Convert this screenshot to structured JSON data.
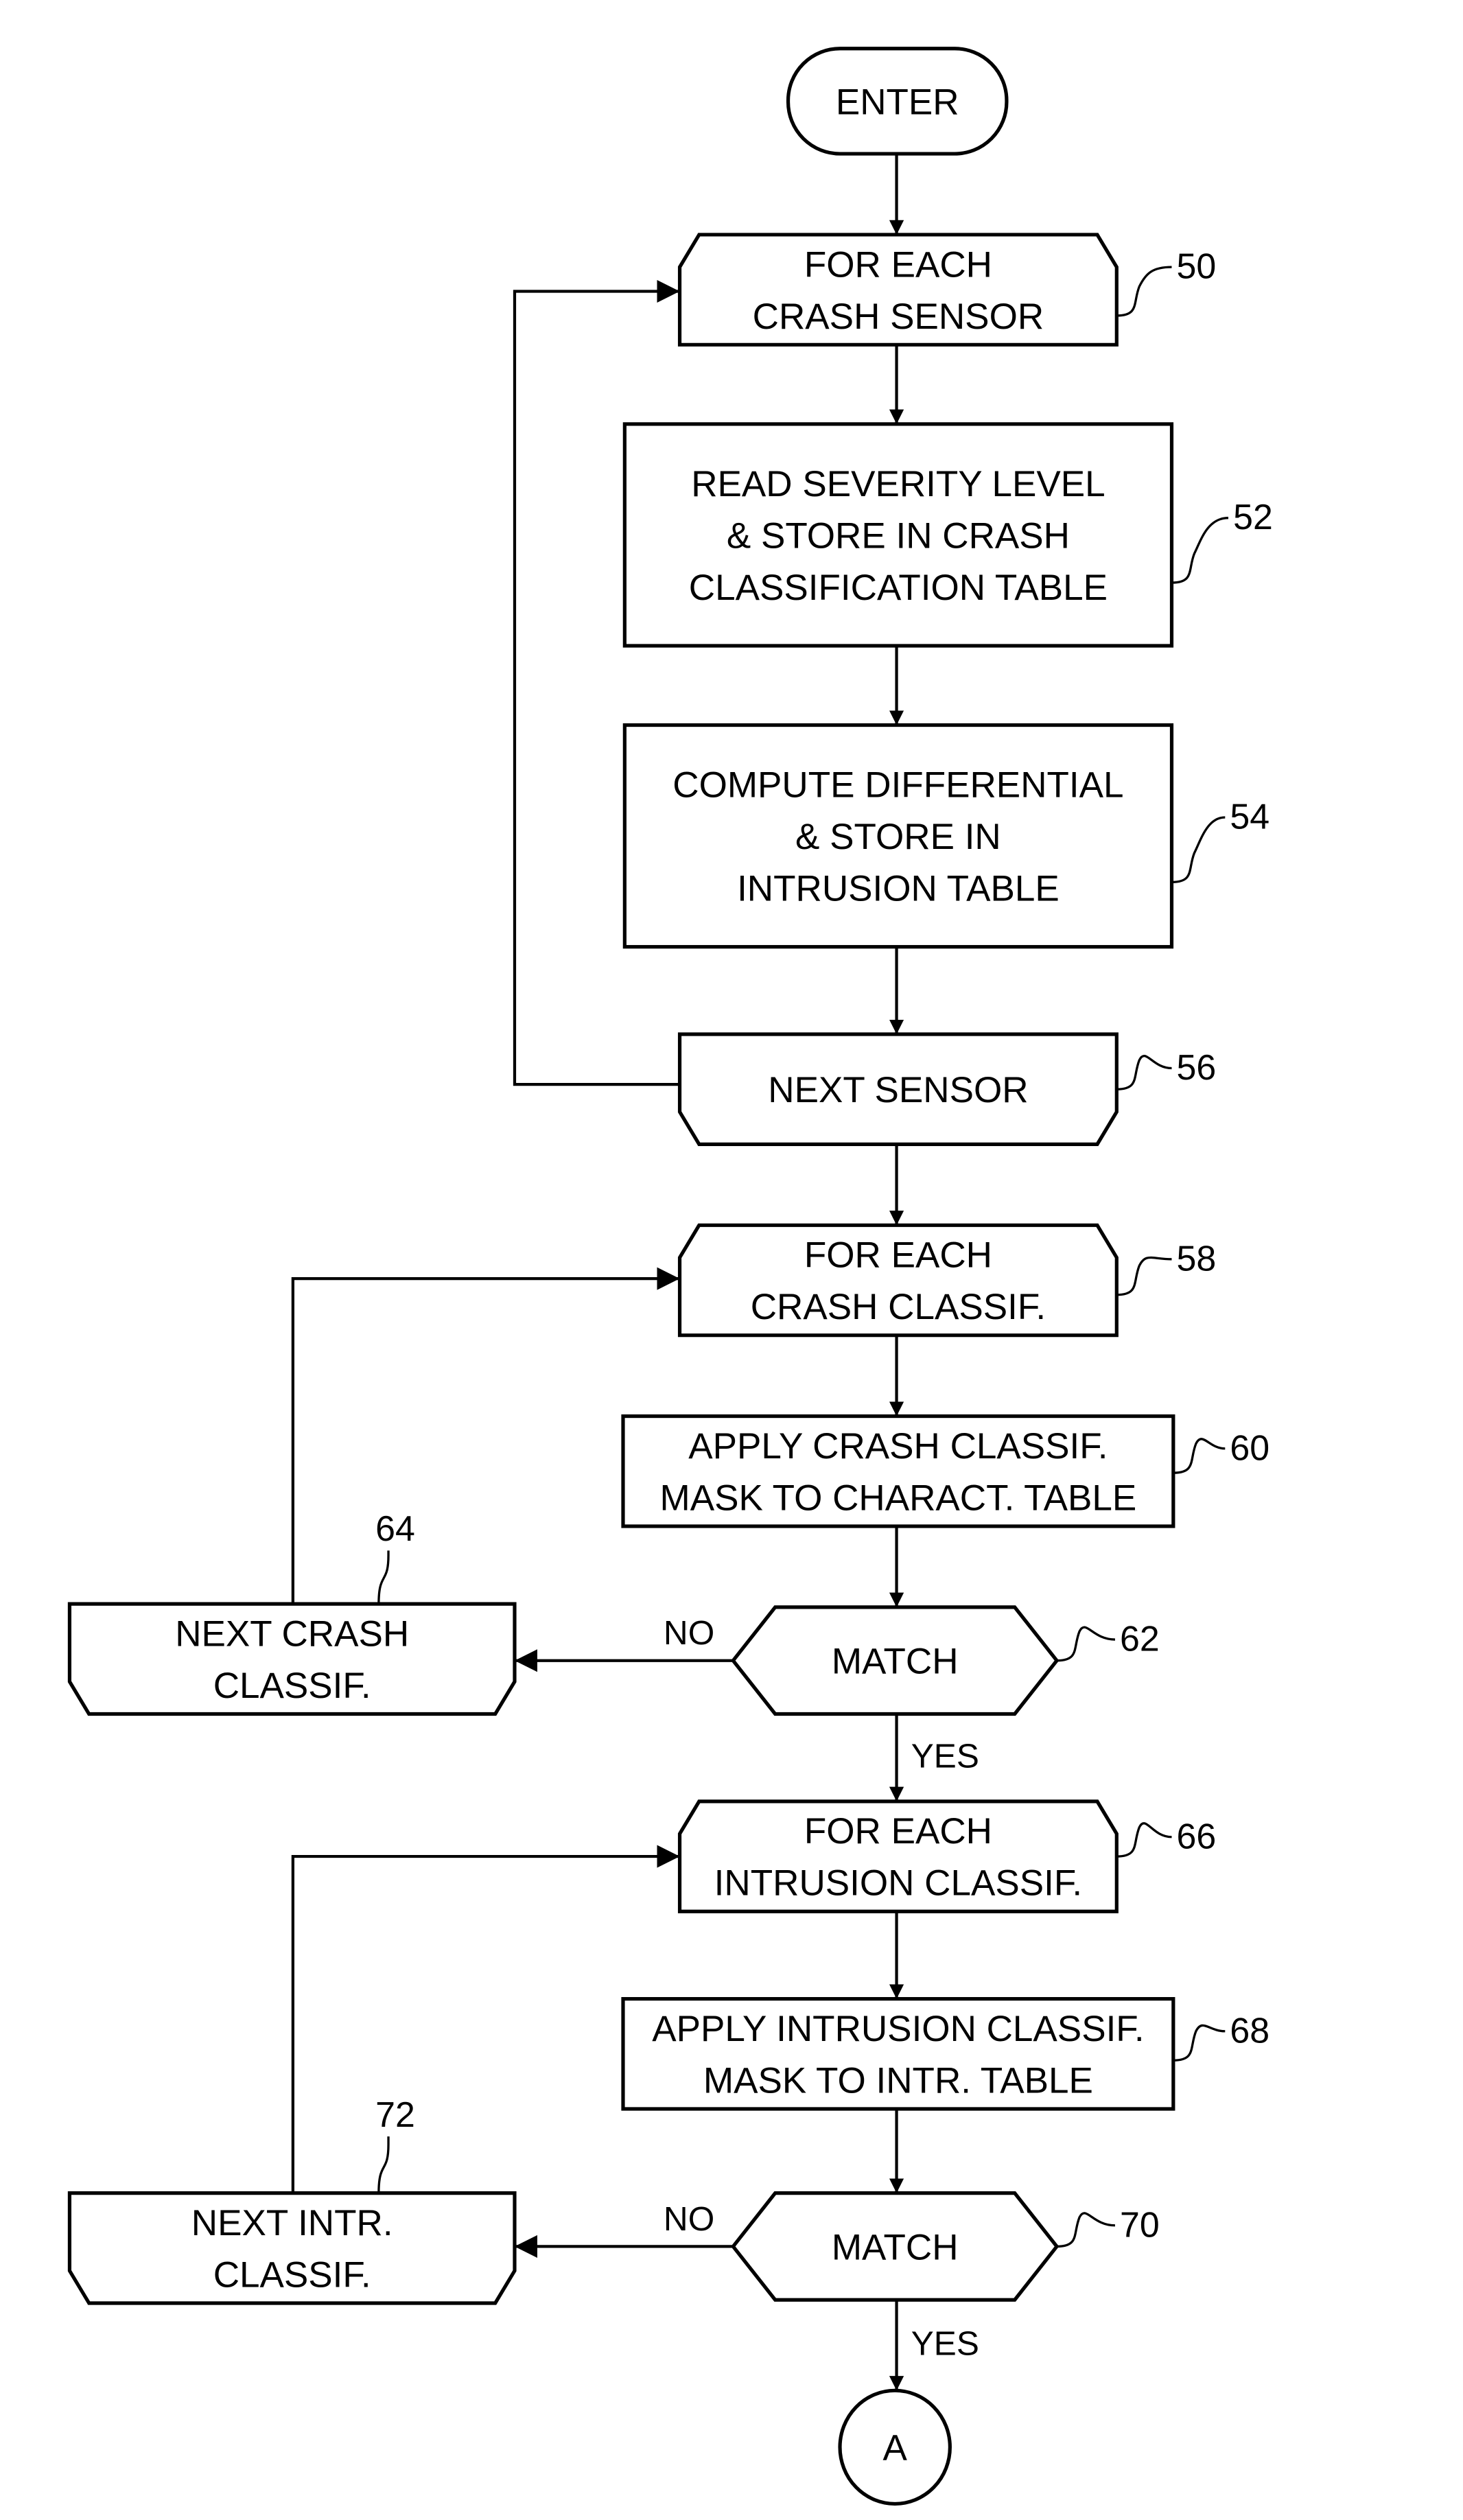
{
  "figure": {
    "nodes": [
      {
        "id": "enter",
        "type": "terminal",
        "lines": [
          "ENTER"
        ],
        "ref": ""
      },
      {
        "id": "n50",
        "type": "loop-start",
        "lines": [
          "FOR EACH",
          "CRASH SENSOR"
        ],
        "ref": "50"
      },
      {
        "id": "n52",
        "type": "process",
        "lines": [
          "READ SEVERITY LEVEL",
          "& STORE IN CRASH",
          "CLASSIFICATION TABLE"
        ],
        "ref": "52"
      },
      {
        "id": "n54",
        "type": "process",
        "lines": [
          "COMPUTE DIFFERENTIAL",
          "& STORE IN",
          "INTRUSION TABLE"
        ],
        "ref": "54"
      },
      {
        "id": "n56",
        "type": "loop-end",
        "lines": [
          "NEXT SENSOR"
        ],
        "ref": "56"
      },
      {
        "id": "n58",
        "type": "loop-start",
        "lines": [
          "FOR EACH",
          "CRASH CLASSIF."
        ],
        "ref": "58"
      },
      {
        "id": "n60",
        "type": "process",
        "lines": [
          "APPLY CRASH CLASSIF.",
          "MASK TO CHARACT. TABLE"
        ],
        "ref": "60"
      },
      {
        "id": "n62",
        "type": "decision",
        "lines": [
          "MATCH"
        ],
        "ref": "62"
      },
      {
        "id": "n64",
        "type": "loop-end",
        "lines": [
          "NEXT CRASH",
          "CLASSIF."
        ],
        "ref": "64"
      },
      {
        "id": "n66",
        "type": "loop-start",
        "lines": [
          "FOR EACH",
          "INTRUSION CLASSIF."
        ],
        "ref": "66"
      },
      {
        "id": "n68",
        "type": "process",
        "lines": [
          "APPLY INTRUSION CLASSIF.",
          "MASK TO INTR. TABLE"
        ],
        "ref": "68"
      },
      {
        "id": "n70",
        "type": "decision",
        "lines": [
          "MATCH"
        ],
        "ref": "70"
      },
      {
        "id": "n72",
        "type": "loop-end",
        "lines": [
          "NEXT INTR.",
          "CLASSIF."
        ],
        "ref": "72"
      },
      {
        "id": "connA",
        "type": "connector",
        "lines": [
          "A"
        ],
        "ref": ""
      }
    ],
    "edges": [
      {
        "from": "enter",
        "to": "n50",
        "label": ""
      },
      {
        "from": "n50",
        "to": "n52",
        "label": ""
      },
      {
        "from": "n52",
        "to": "n54",
        "label": ""
      },
      {
        "from": "n54",
        "to": "n56",
        "label": ""
      },
      {
        "from": "n56",
        "to": "n50",
        "label": ""
      },
      {
        "from": "n56",
        "to": "n58",
        "label": ""
      },
      {
        "from": "n58",
        "to": "n60",
        "label": ""
      },
      {
        "from": "n60",
        "to": "n62",
        "label": ""
      },
      {
        "from": "n62",
        "to": "n64",
        "label": "NO"
      },
      {
        "from": "n64",
        "to": "n58",
        "label": ""
      },
      {
        "from": "n62",
        "to": "n66",
        "label": "YES"
      },
      {
        "from": "n66",
        "to": "n68",
        "label": ""
      },
      {
        "from": "n68",
        "to": "n70",
        "label": ""
      },
      {
        "from": "n70",
        "to": "n72",
        "label": "NO"
      },
      {
        "from": "n72",
        "to": "n66",
        "label": ""
      },
      {
        "from": "n70",
        "to": "connA",
        "label": "YES"
      }
    ]
  }
}
